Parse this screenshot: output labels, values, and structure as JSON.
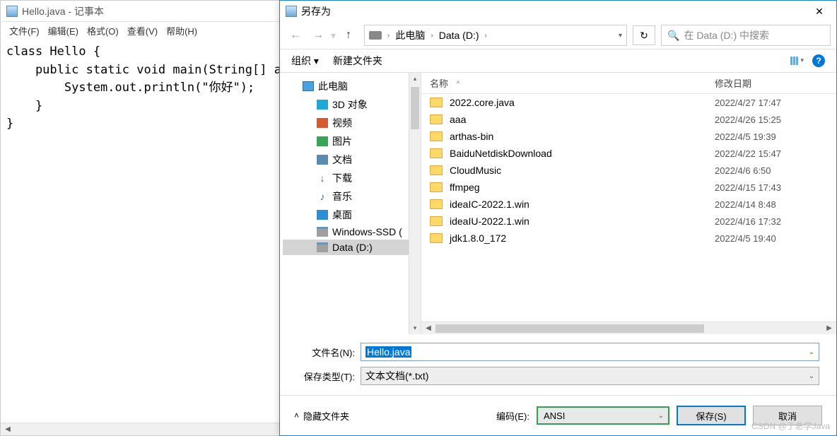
{
  "notepad": {
    "title": "Hello.java - 记事本",
    "menu": {
      "file": "文件(F)",
      "edit": "编辑(E)",
      "format": "格式(O)",
      "view": "查看(V)",
      "help": "帮助(H)"
    },
    "content": "class Hello {\n    public static void main(String[] args) {\n        System.out.println(\"你好\");\n    }\n}"
  },
  "dialog": {
    "title": "另存为",
    "nav": {
      "back": "←",
      "fwd": "→",
      "up": "↑"
    },
    "breadcrumb": {
      "pc": "此电脑",
      "drive": "Data (D:)"
    },
    "refresh": "↻",
    "search": {
      "icon": "🔍",
      "placeholder": "在 Data (D:) 中搜索"
    },
    "toolbar": {
      "organize": "组织 ▾",
      "newfolder": "新建文件夹",
      "help": "?"
    },
    "tree": [
      {
        "label": "此电脑",
        "icon": "pc",
        "level": 1
      },
      {
        "label": "3D 对象",
        "icon": "3d",
        "level": 2
      },
      {
        "label": "视频",
        "icon": "video",
        "level": 2
      },
      {
        "label": "图片",
        "icon": "pic",
        "level": 2
      },
      {
        "label": "文档",
        "icon": "doc",
        "level": 2
      },
      {
        "label": "下载",
        "icon": "dl",
        "level": 2
      },
      {
        "label": "音乐",
        "icon": "music",
        "level": 2
      },
      {
        "label": "桌面",
        "icon": "desktop",
        "level": 2
      },
      {
        "label": "Windows-SSD (",
        "icon": "disk",
        "level": 2
      },
      {
        "label": "Data (D:)",
        "icon": "disk",
        "level": 2,
        "selected": true
      }
    ],
    "columns": {
      "name": "名称",
      "date": "修改日期"
    },
    "files": [
      {
        "name": "2022.core.java",
        "date": "2022/4/27 17:47"
      },
      {
        "name": "aaa",
        "date": "2022/4/26 15:25"
      },
      {
        "name": "arthas-bin",
        "date": "2022/4/5 19:39"
      },
      {
        "name": "BaiduNetdiskDownload",
        "date": "2022/4/22 15:47"
      },
      {
        "name": "CloudMusic",
        "date": "2022/4/6 6:50"
      },
      {
        "name": "ffmpeg",
        "date": "2022/4/15 17:43"
      },
      {
        "name": "ideaIC-2022.1.win",
        "date": "2022/4/14 8:48"
      },
      {
        "name": "ideaIU-2022.1.win",
        "date": "2022/4/16 17:32"
      },
      {
        "name": "jdk1.8.0_172",
        "date": "2022/4/5 19:40"
      }
    ],
    "filename": {
      "label": "文件名(N):",
      "value": "Hello.java"
    },
    "filetype": {
      "label": "保存类型(T):",
      "value": "文本文档(*.txt)"
    },
    "footer": {
      "hideFolders": "隐藏文件夹",
      "encodingLabel": "编码(E):",
      "encoding": "ANSI",
      "save": "保存(S)",
      "cancel": "取消"
    }
  },
  "watermark": "CSDN @丁总学Java"
}
